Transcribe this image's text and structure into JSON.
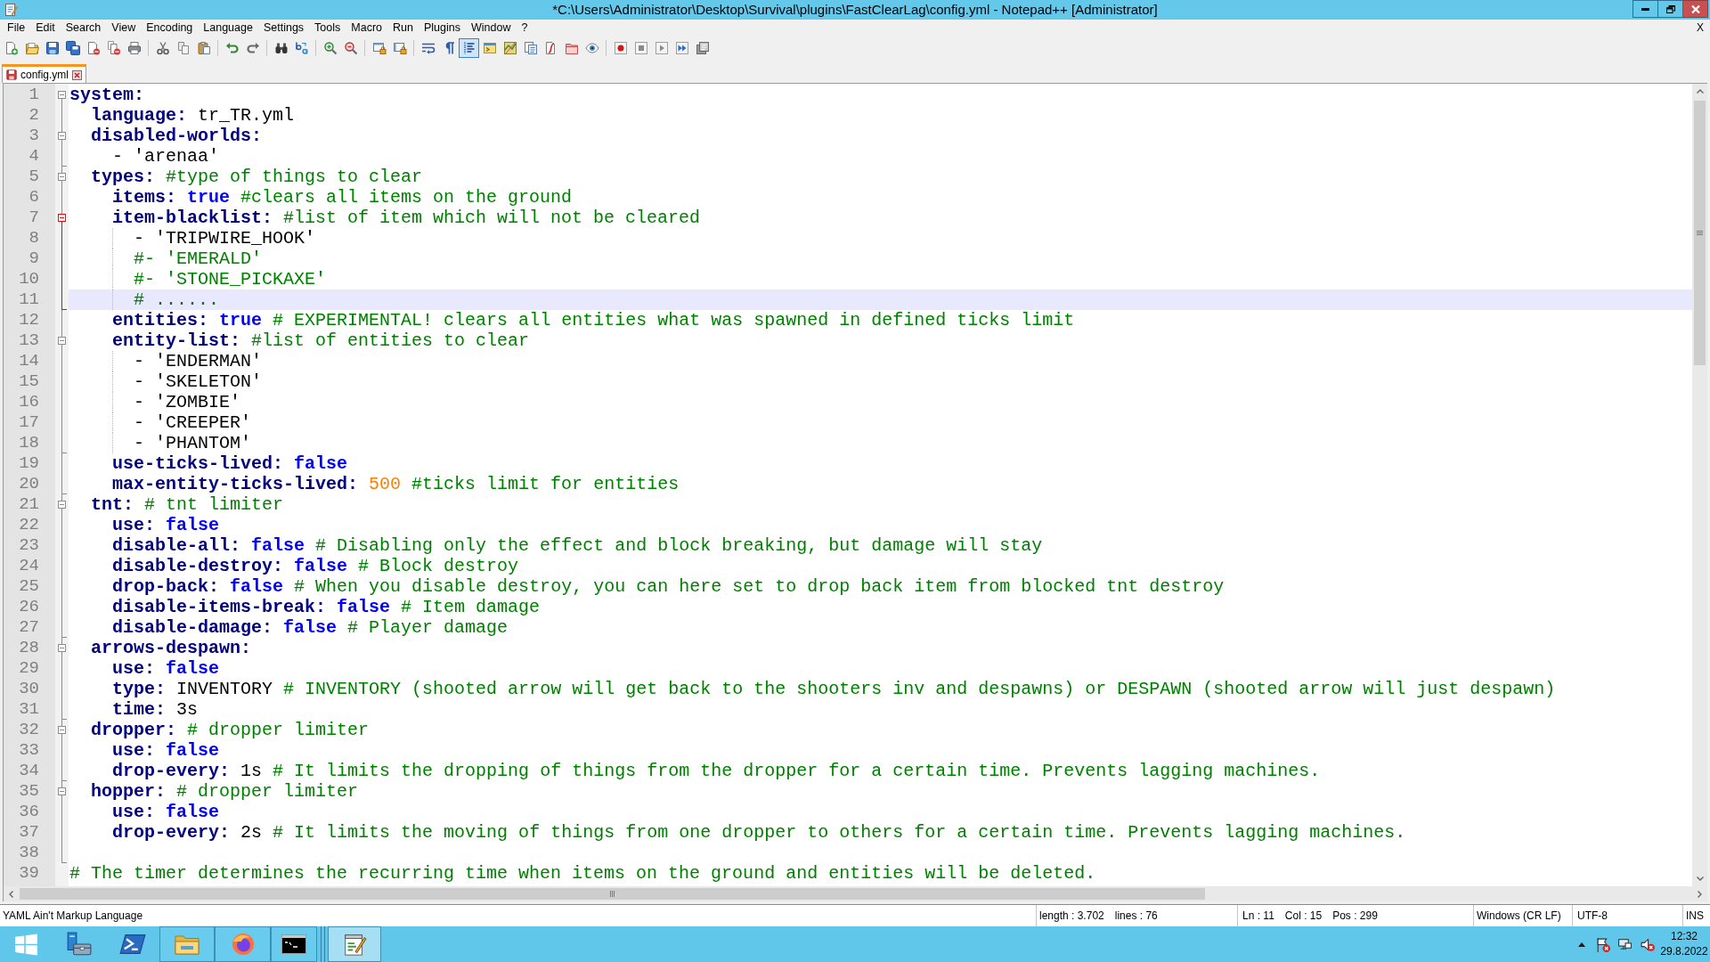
{
  "window": {
    "title": "*C:\\Users\\Administrator\\Desktop\\Survival\\plugins\\FastClearLag\\config.yml - Notepad++ [Administrator]"
  },
  "menu": {
    "items": [
      "File",
      "Edit",
      "Search",
      "View",
      "Encoding",
      "Language",
      "Settings",
      "Tools",
      "Macro",
      "Run",
      "Plugins",
      "Window",
      "?"
    ],
    "close_label": "X"
  },
  "toolbar": [
    {
      "on": false
    },
    {
      "on": false
    },
    {
      "on": false
    },
    {
      "on": false
    },
    {
      "on": false
    },
    {
      "on": false
    },
    {
      "on": false
    },
    {
      "on": false
    },
    {
      "on": false
    },
    {
      "on": false
    },
    {
      "on": false
    },
    {
      "on": false
    },
    {
      "on": false
    },
    {
      "on": false
    },
    {
      "on": false
    },
    {
      "on": false
    },
    {
      "on": false
    },
    {
      "on": false
    },
    {
      "on": false
    },
    {
      "on": false
    },
    {
      "on": true
    },
    {
      "on": false
    },
    {
      "on": false
    },
    {
      "on": false
    },
    {
      "on": false
    },
    {
      "on": false
    },
    {
      "on": false
    },
    {
      "on": false
    },
    {
      "on": false
    },
    {
      "on": false
    },
    {
      "on": false
    },
    {
      "on": false
    }
  ],
  "tabs": [
    {
      "label": "config.yml",
      "selected": true,
      "modified": true
    }
  ],
  "editor": {
    "lines": [
      {
        "number": "1",
        "current": false,
        "segments": [
          {
            "kind": "key",
            "text": "system:"
          }
        ],
        "children": [
          {
            "number": "2",
            "current": false,
            "segments": [
              {
                "kind": "key",
                "text": "language:"
              },
              {
                "kind": "plain",
                "text": "tr_TR.yml"
              }
            ]
          },
          {
            "number": "3",
            "current": false,
            "segments": [
              {
                "kind": "key",
                "text": "disabled-worlds:"
              }
            ],
            "children": [
              {
                "number": "4",
                "current": false,
                "segments": [
                  {
                    "kind": "plain",
                    "text": "- 'arenaa'"
                  }
                ]
              }
            ]
          },
          {
            "number": "5",
            "current": false,
            "segments": [
              {
                "kind": "key",
                "text": "types:"
              },
              {
                "kind": "comment",
                "text": "#type of things to clear"
              }
            ],
            "children": [
              {
                "number": "6",
                "current": false,
                "segments": [
                  {
                    "kind": "key",
                    "text": "items:"
                  },
                  {
                    "kind": "bool",
                    "text": "true"
                  },
                  {
                    "kind": "comment",
                    "text": "#clears all items on the ground"
                  }
                ]
              },
              {
                "number": "7",
                "current": false,
                "segments": [
                  {
                    "kind": "key",
                    "text": "item-blacklist:"
                  },
                  {
                    "kind": "comment",
                    "text": "#list of item which will not be cleared"
                  }
                ],
                "children": [
                  {
                    "number": "8",
                    "current": false,
                    "segments": [
                      {
                        "kind": "plain",
                        "text": "- 'TRIPWIRE_HOOK'"
                      }
                    ]
                  },
                  {
                    "number": "9",
                    "current": false,
                    "segments": [
                      {
                        "kind": "comment",
                        "text": "#- 'EMERALD'"
                      }
                    ]
                  },
                  {
                    "number": "10",
                    "current": false,
                    "segments": [
                      {
                        "kind": "comment",
                        "text": "#- 'STONE_PICKAXE'"
                      }
                    ]
                  },
                  {
                    "number": "11",
                    "current": true,
                    "segments": [
                      {
                        "kind": "comment",
                        "text": "# ......"
                      }
                    ]
                  }
                ]
              },
              {
                "number": "12",
                "current": false,
                "segments": [
                  {
                    "kind": "key",
                    "text": "entities:"
                  },
                  {
                    "kind": "bool",
                    "text": "true"
                  },
                  {
                    "kind": "comment",
                    "text": "# EXPERIMENTAL! clears all entities what was spawned in defined ticks limit"
                  }
                ]
              },
              {
                "number": "13",
                "current": false,
                "segments": [
                  {
                    "kind": "key",
                    "text": "entity-list:"
                  },
                  {
                    "kind": "comment",
                    "text": "#list of entities to clear"
                  }
                ],
                "children": [
                  {
                    "number": "14",
                    "current": false,
                    "segments": [
                      {
                        "kind": "plain",
                        "text": "- 'ENDERMAN'"
                      }
                    ]
                  },
                  {
                    "number": "15",
                    "current": false,
                    "segments": [
                      {
                        "kind": "plain",
                        "text": "- 'SKELETON'"
                      }
                    ]
                  },
                  {
                    "number": "16",
                    "current": false,
                    "segments": [
                      {
                        "kind": "plain",
                        "text": "- 'ZOMBIE'"
                      }
                    ]
                  },
                  {
                    "number": "17",
                    "current": false,
                    "segments": [
                      {
                        "kind": "plain",
                        "text": "- 'CREEPER'"
                      }
                    ]
                  },
                  {
                    "number": "18",
                    "current": false,
                    "segments": [
                      {
                        "kind": "plain",
                        "text": "- 'PHANTOM'"
                      }
                    ]
                  }
                ]
              },
              {
                "number": "19",
                "current": false,
                "segments": [
                  {
                    "kind": "key",
                    "text": "use-ticks-lived:"
                  },
                  {
                    "kind": "bool",
                    "text": "false"
                  }
                ]
              },
              {
                "number": "20",
                "current": false,
                "segments": [
                  {
                    "kind": "key",
                    "text": "max-entity-ticks-lived:"
                  },
                  {
                    "kind": "number",
                    "text": "500"
                  },
                  {
                    "kind": "comment",
                    "text": "#ticks limit for entities"
                  }
                ]
              }
            ]
          },
          {
            "number": "21",
            "current": false,
            "segments": [
              {
                "kind": "key",
                "text": "tnt:"
              },
              {
                "kind": "comment",
                "text": "# tnt limiter"
              }
            ],
            "children": [
              {
                "number": "22",
                "current": false,
                "segments": [
                  {
                    "kind": "key",
                    "text": "use:"
                  },
                  {
                    "kind": "bool",
                    "text": "false"
                  }
                ]
              },
              {
                "number": "23",
                "current": false,
                "segments": [
                  {
                    "kind": "key",
                    "text": "disable-all:"
                  },
                  {
                    "kind": "bool",
                    "text": "false"
                  },
                  {
                    "kind": "comment",
                    "text": "# Disabling only the effect and block breaking, but damage will stay"
                  }
                ]
              },
              {
                "number": "24",
                "current": false,
                "segments": [
                  {
                    "kind": "key",
                    "text": "disable-destroy:"
                  },
                  {
                    "kind": "bool",
                    "text": "false"
                  },
                  {
                    "kind": "comment",
                    "text": "# Block destroy"
                  }
                ]
              },
              {
                "number": "25",
                "current": false,
                "segments": [
                  {
                    "kind": "key",
                    "text": "drop-back:"
                  },
                  {
                    "kind": "bool",
                    "text": "false"
                  },
                  {
                    "kind": "comment",
                    "text": "# When you disable destroy, you can here set to drop back item from blocked tnt destroy"
                  }
                ]
              },
              {
                "number": "26",
                "current": false,
                "segments": [
                  {
                    "kind": "key",
                    "text": "disable-items-break:"
                  },
                  {
                    "kind": "bool",
                    "text": "false"
                  },
                  {
                    "kind": "comment",
                    "text": "# Item damage"
                  }
                ]
              },
              {
                "number": "27",
                "current": false,
                "segments": [
                  {
                    "kind": "key",
                    "text": "disable-damage:"
                  },
                  {
                    "kind": "bool",
                    "text": "false"
                  },
                  {
                    "kind": "comment",
                    "text": "# Player damage"
                  }
                ]
              }
            ]
          },
          {
            "number": "28",
            "current": false,
            "segments": [
              {
                "kind": "key",
                "text": "arrows-despawn:"
              }
            ],
            "children": [
              {
                "number": "29",
                "current": false,
                "segments": [
                  {
                    "kind": "key",
                    "text": "use:"
                  },
                  {
                    "kind": "bool",
                    "text": "false"
                  }
                ]
              },
              {
                "number": "30",
                "current": false,
                "segments": [
                  {
                    "kind": "key",
                    "text": "type:"
                  },
                  {
                    "kind": "plain",
                    "text": "INVENTORY"
                  },
                  {
                    "kind": "comment",
                    "text": "# INVENTORY (shooted arrow will get back to the shooters inv and despawns) or DESPAWN (shooted arrow will just despawn)"
                  }
                ]
              },
              {
                "number": "31",
                "current": false,
                "segments": [
                  {
                    "kind": "key",
                    "text": "time:"
                  },
                  {
                    "kind": "plain",
                    "text": "3s"
                  }
                ]
              }
            ]
          },
          {
            "number": "32",
            "current": false,
            "segments": [
              {
                "kind": "key",
                "text": "dropper:"
              },
              {
                "kind": "comment",
                "text": "# dropper limiter"
              }
            ],
            "children": [
              {
                "number": "33",
                "current": false,
                "segments": [
                  {
                    "kind": "key",
                    "text": "use:"
                  },
                  {
                    "kind": "bool",
                    "text": "false"
                  }
                ]
              },
              {
                "number": "34",
                "current": false,
                "segments": [
                  {
                    "kind": "key",
                    "text": "drop-every:"
                  },
                  {
                    "kind": "plain",
                    "text": "1s"
                  },
                  {
                    "kind": "comment",
                    "text": "# It limits the dropping of things from the dropper for a certain time. Prevents lagging machines."
                  }
                ]
              }
            ]
          },
          {
            "number": "35",
            "current": false,
            "segments": [
              {
                "kind": "key",
                "text": "hopper:"
              },
              {
                "kind": "comment",
                "text": "# dropper limiter"
              }
            ],
            "children": [
              {
                "number": "36",
                "current": false,
                "segments": [
                  {
                    "kind": "key",
                    "text": "use:"
                  },
                  {
                    "kind": "bool",
                    "text": "false"
                  }
                ]
              },
              {
                "number": "37",
                "current": false,
                "segments": [
                  {
                    "kind": "key",
                    "text": "drop-every:"
                  },
                  {
                    "kind": "plain",
                    "text": "2s"
                  },
                  {
                    "kind": "comment",
                    "text": "# It limits the moving of things from one dropper to others for a certain time. Prevents lagging machines."
                  }
                ]
              },
              {
                "number": "38",
                "current": false
              }
            ]
          }
        ]
      },
      {
        "number": "39",
        "current": false,
        "segments": [
          {
            "kind": "comment",
            "text": "# The timer determines the recurring time when items on the ground and entities will be deleted."
          }
        ]
      }
    ]
  },
  "status_bar": {
    "file_type": "YAML Ain't Markup Language",
    "length": "length : 3.702",
    "lines": "lines : 76",
    "line": "Ln : 11",
    "column": "Col : 15",
    "position": "Pos : 299",
    "line_endings": "Windows (CR LF)",
    "encoding": "UTF-8",
    "insert_mode": "INS"
  },
  "taskbar": {
    "apps": [
      {
        "running": false,
        "active": false
      },
      {
        "running": false,
        "active": false
      },
      {
        "running": true,
        "active": false
      },
      {
        "running": true,
        "active": false
      },
      {
        "running": true,
        "active": false
      },
      {
        "running": true,
        "active": true
      }
    ],
    "clock": {
      "time": "12:32",
      "date": "29.8.2022"
    }
  }
}
